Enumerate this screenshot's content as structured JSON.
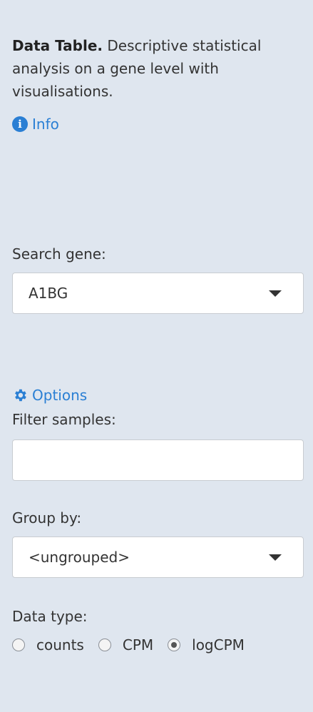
{
  "intro": {
    "title": "Data Table.",
    "description": " Descriptive statistical analysis on a gene level with visualisations."
  },
  "info_link": {
    "label": "Info",
    "icon": "info-icon"
  },
  "search_gene": {
    "label": "Search gene:",
    "selected": "A1BG"
  },
  "options_link": {
    "label": "Options",
    "icon": "gear-icon"
  },
  "filter_samples": {
    "label": "Filter samples:",
    "value": ""
  },
  "group_by": {
    "label": "Group by:",
    "selected": "<ungrouped>"
  },
  "data_type": {
    "label": "Data type:",
    "options": [
      "counts",
      "CPM",
      "logCPM"
    ],
    "selected": "logCPM"
  },
  "colors": {
    "background": "#dfe6ef",
    "link": "#2a7fd4"
  }
}
